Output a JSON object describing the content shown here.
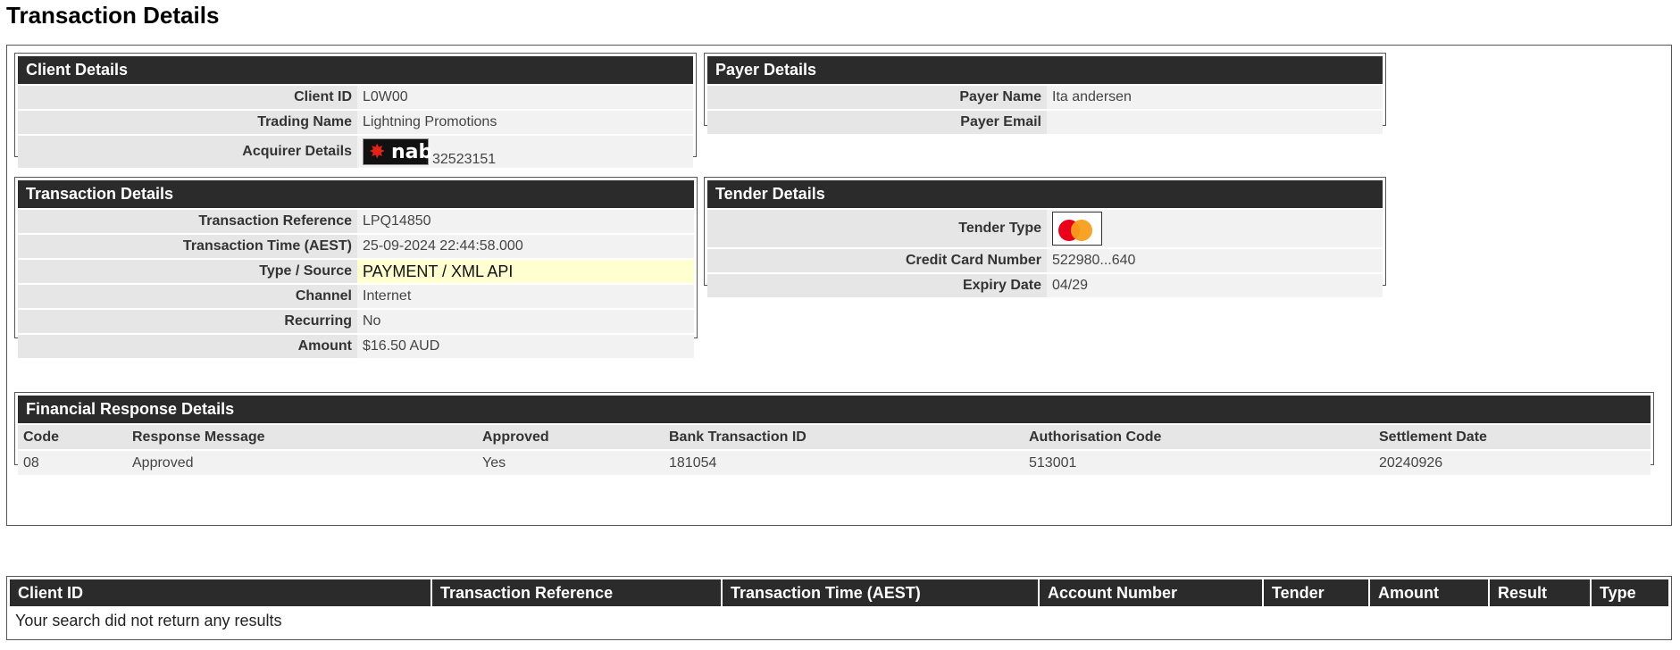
{
  "page": {
    "title": "Transaction Details"
  },
  "client": {
    "header": "Client Details",
    "client_id_label": "Client ID",
    "client_id": "L0W00",
    "trading_name_label": "Trading Name",
    "trading_name": "Lightning Promotions",
    "acquirer_label": "Acquirer Details",
    "acquirer_logo_text": "nab",
    "acquirer_number": "32523151"
  },
  "payer": {
    "header": "Payer Details",
    "name_label": "Payer Name",
    "name": "Ita andersen",
    "email_label": "Payer Email",
    "email": ""
  },
  "transaction": {
    "header": "Transaction Details",
    "reference_label": "Transaction Reference",
    "reference": "LPQ14850",
    "time_label": "Transaction Time (AEST)",
    "time": "25-09-2024 22:44:58.000",
    "type_label": "Type / Source",
    "type": "PAYMENT / XML API",
    "channel_label": "Channel",
    "channel": "Internet",
    "recurring_label": "Recurring",
    "recurring": "No",
    "amount_label": "Amount",
    "amount": "$16.50 AUD"
  },
  "tender": {
    "header": "Tender Details",
    "type_label": "Tender Type",
    "type_icon": "mastercard-icon",
    "card_label": "Credit Card Number",
    "card": "522980...640",
    "expiry_label": "Expiry Date",
    "expiry": "04/29"
  },
  "financial": {
    "header": "Financial Response Details",
    "columns": [
      "Code",
      "Response Message",
      "Approved",
      "Bank Transaction ID",
      "Authorisation Code",
      "Settlement Date"
    ],
    "row": [
      "08",
      "Approved",
      "Yes",
      "181054",
      "513001",
      "20240926"
    ]
  },
  "results": {
    "columns": [
      "Client ID",
      "Transaction Reference",
      "Transaction Time (AEST)",
      "Account Number",
      "Tender",
      "Amount",
      "Result",
      "Type"
    ],
    "empty_message": "Your search did not return any results"
  },
  "colors": {
    "header_bg": "#2b2b2b",
    "highlight": "#ffffd0",
    "mastercard_red": "#eb001b",
    "mastercard_orange": "#f79e1b",
    "nab_red": "#e2231a"
  }
}
